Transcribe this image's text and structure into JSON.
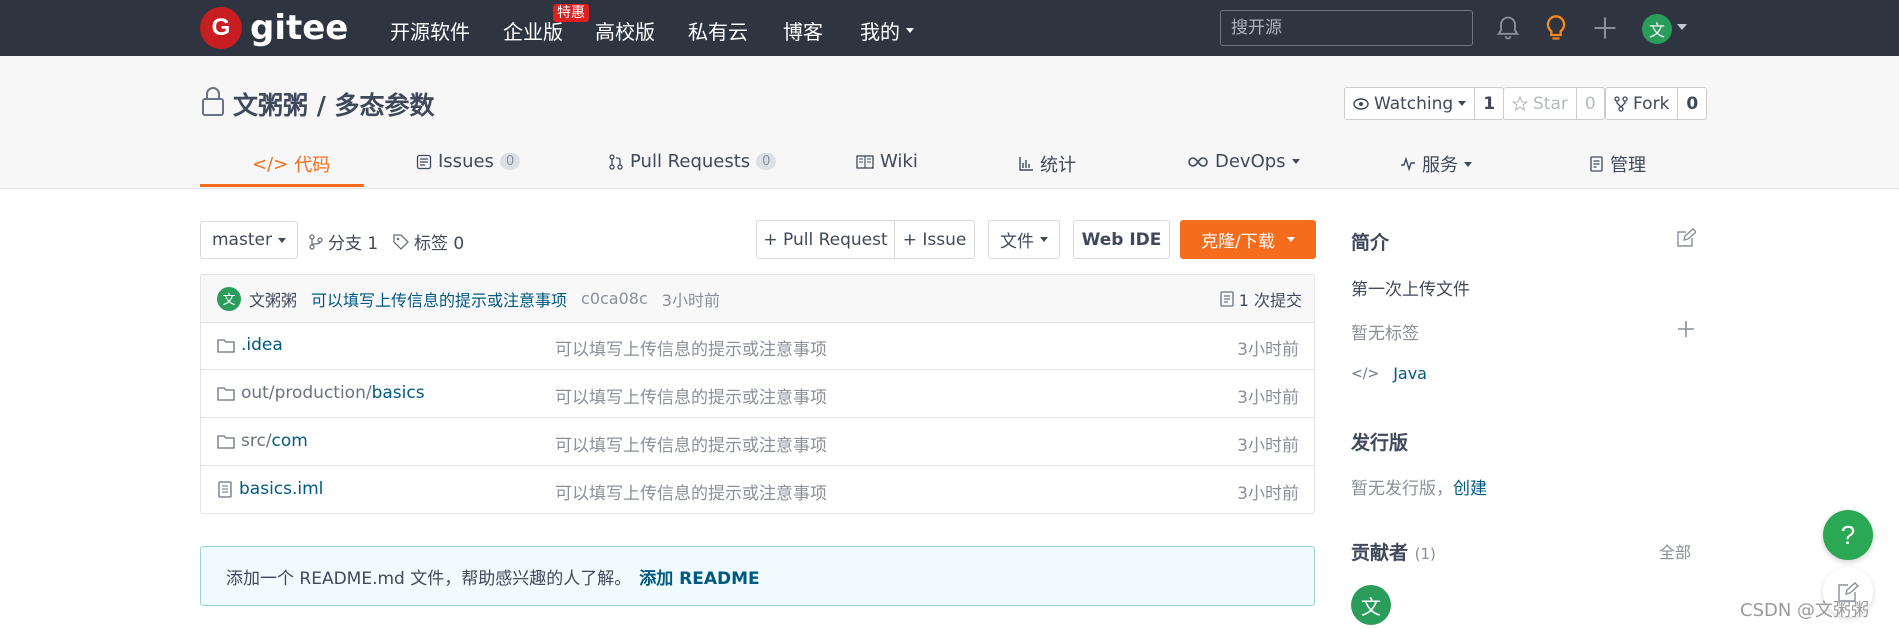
{
  "topbar": {
    "logo_text": "gitee",
    "logo_letter": "G",
    "nav": [
      "开源软件",
      "企业版",
      "高校版",
      "私有云",
      "博客",
      "我的"
    ],
    "badge": "特惠",
    "search_placeholder": "搜开源",
    "avatar": "文"
  },
  "project": {
    "title": "文粥粥 / 多态参数",
    "watching_label": "Watching",
    "watching_count": "1",
    "star_label": "Star",
    "star_count": "0",
    "fork_label": "Fork",
    "fork_count": "0"
  },
  "tabs": [
    {
      "label": "代码"
    },
    {
      "label": "Issues",
      "badge": "0"
    },
    {
      "label": "Pull Requests",
      "badge": "0"
    },
    {
      "label": "Wiki"
    },
    {
      "label": "统计"
    },
    {
      "label": "DevOps"
    },
    {
      "label": "服务"
    },
    {
      "label": "管理"
    }
  ],
  "toolbar": {
    "branch": "master",
    "branches": "分支 1",
    "tags": "标签 0",
    "pull_request": "+ Pull Request",
    "issue": "+ Issue",
    "files": "文件",
    "web_ide": "Web IDE",
    "clone": "克隆/下载"
  },
  "commit": {
    "avatar": "文",
    "author": "文粥粥",
    "message": "可以填写上传信息的提示或注意事项",
    "hash": "c0ca08c",
    "time": "3小时前",
    "count": "1 次提交"
  },
  "files": [
    {
      "prefix": "",
      "name": ".idea",
      "message": "可以填写上传信息的提示或注意事项",
      "time": "3小时前",
      "type": "folder"
    },
    {
      "prefix": "out/production/",
      "name": "basics",
      "message": "可以填写上传信息的提示或注意事项",
      "time": "3小时前",
      "type": "folder"
    },
    {
      "prefix": "src/",
      "name": "com",
      "message": "可以填写上传信息的提示或注意事项",
      "time": "3小时前",
      "type": "folder"
    },
    {
      "prefix": "",
      "name": "basics.iml",
      "message": "可以填写上传信息的提示或注意事项",
      "time": "3小时前",
      "type": "file"
    }
  ],
  "readme": {
    "text": "添加一个 README.md 文件，帮助感兴趣的人了解。",
    "link": "添加 README"
  },
  "sidebar": {
    "intro_title": "简介",
    "intro_text": "第一次上传文件",
    "no_tags": "暂无标签",
    "language": "Java",
    "release_title": "发行版",
    "no_release": "暂无发行版，",
    "create": "创建",
    "contributors_title": "贡献者",
    "contributors_count": "(1)",
    "all": "全部",
    "contributor_avatar": "文"
  },
  "help_label": "?",
  "watermark": "CSDN @文粥粥",
  "colors": {
    "accent": "#f56c1d",
    "topbar": "#2e3440",
    "link": "#005980",
    "green": "#2aa853"
  }
}
